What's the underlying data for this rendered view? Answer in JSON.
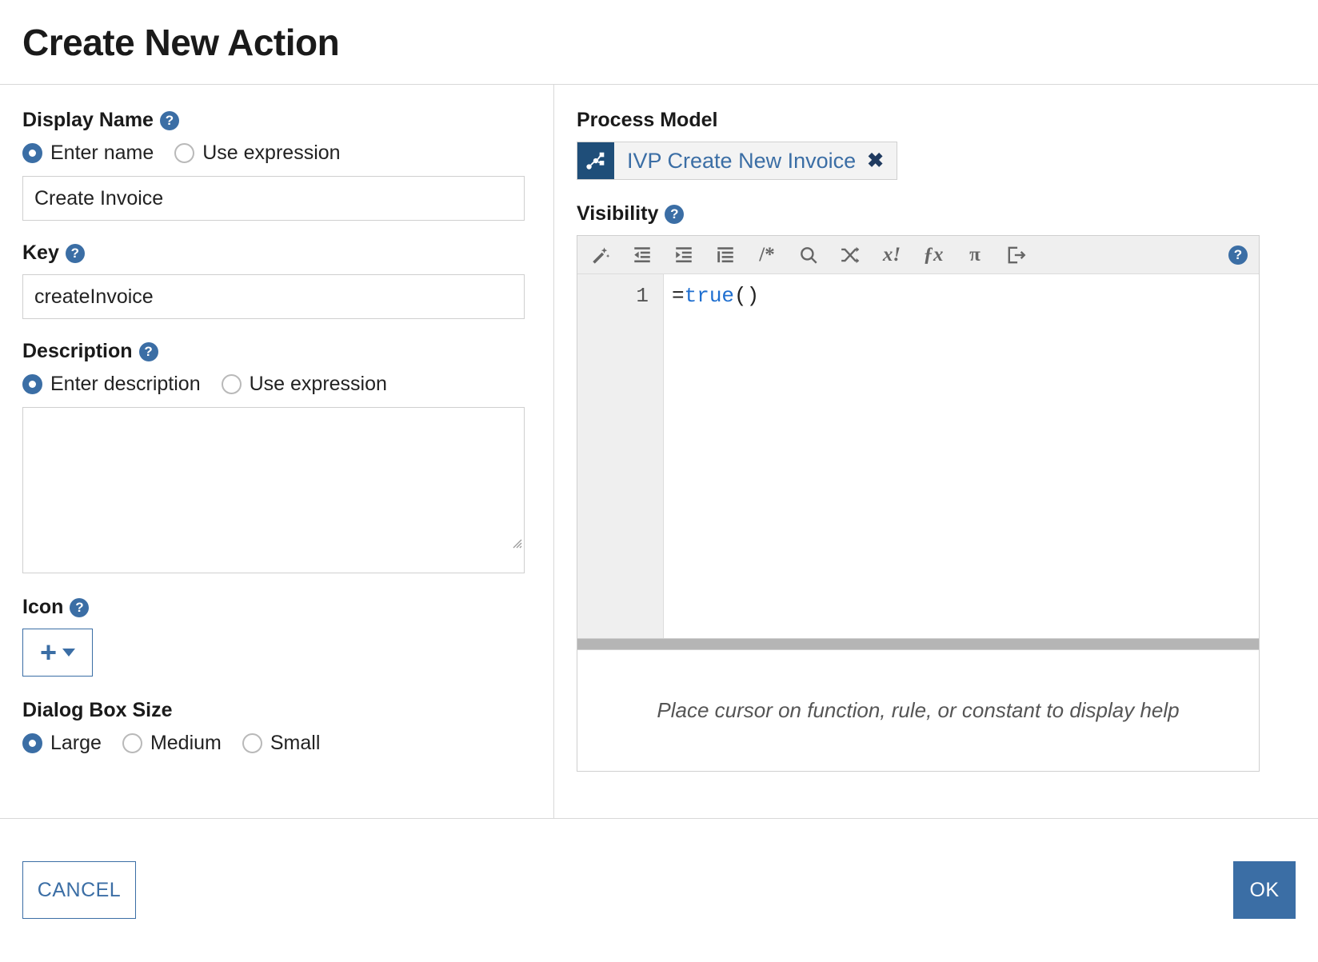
{
  "dialog": {
    "title": "Create New Action"
  },
  "display_name": {
    "label": "Display Name",
    "help_icon": "help-icon",
    "options": [
      {
        "label": "Enter name",
        "selected": true
      },
      {
        "label": "Use expression",
        "selected": false
      }
    ],
    "value": "Create Invoice",
    "placeholder": ""
  },
  "key": {
    "label": "Key",
    "value": "createInvoice",
    "placeholder": ""
  },
  "description": {
    "label": "Description",
    "options": [
      {
        "label": "Enter description",
        "selected": true
      },
      {
        "label": "Use expression",
        "selected": false
      }
    ],
    "value": "",
    "placeholder": ""
  },
  "icon_field": {
    "label": "Icon",
    "add_glyph": "+",
    "caret": "chevron-down-icon"
  },
  "dialog_size": {
    "label": "Dialog Box Size",
    "options": [
      {
        "label": "Large",
        "selected": true
      },
      {
        "label": "Medium",
        "selected": false
      },
      {
        "label": "Small",
        "selected": false
      }
    ]
  },
  "process_model": {
    "label": "Process Model",
    "chip_label": "IVP Create New Invoice",
    "chip_icon": "process-model-icon",
    "close_glyph": "✖"
  },
  "visibility": {
    "label": "Visibility",
    "toolbar": [
      {
        "name": "magic-wand-icon",
        "glyph": ""
      },
      {
        "name": "outdent-icon",
        "glyph": ""
      },
      {
        "name": "indent-icon",
        "glyph": ""
      },
      {
        "name": "format-list-icon",
        "glyph": ""
      },
      {
        "name": "comment-icon",
        "glyph": "/*"
      },
      {
        "name": "search-icon",
        "glyph": ""
      },
      {
        "name": "shuffle-icon",
        "glyph": ""
      },
      {
        "name": "clear-variable-icon",
        "glyph": "x!"
      },
      {
        "name": "function-icon",
        "glyph": "ƒx"
      },
      {
        "name": "pi-icon",
        "glyph": "π"
      },
      {
        "name": "export-icon",
        "glyph": ""
      }
    ],
    "toolbar_help_icon": "help-icon",
    "line_numbers": [
      "1"
    ],
    "code": {
      "prefix": "=",
      "keyword": "true",
      "suffix": "()"
    },
    "help_message": "Place cursor on function, rule, or constant to display help"
  },
  "footer": {
    "cancel_label": "CANCEL",
    "ok_label": "OK"
  },
  "colors": {
    "accent": "#3b6ea5",
    "chip_icon_bg": "#1f4e79",
    "keyword": "#1f6fd0",
    "toolbar_bg": "#efefef"
  }
}
